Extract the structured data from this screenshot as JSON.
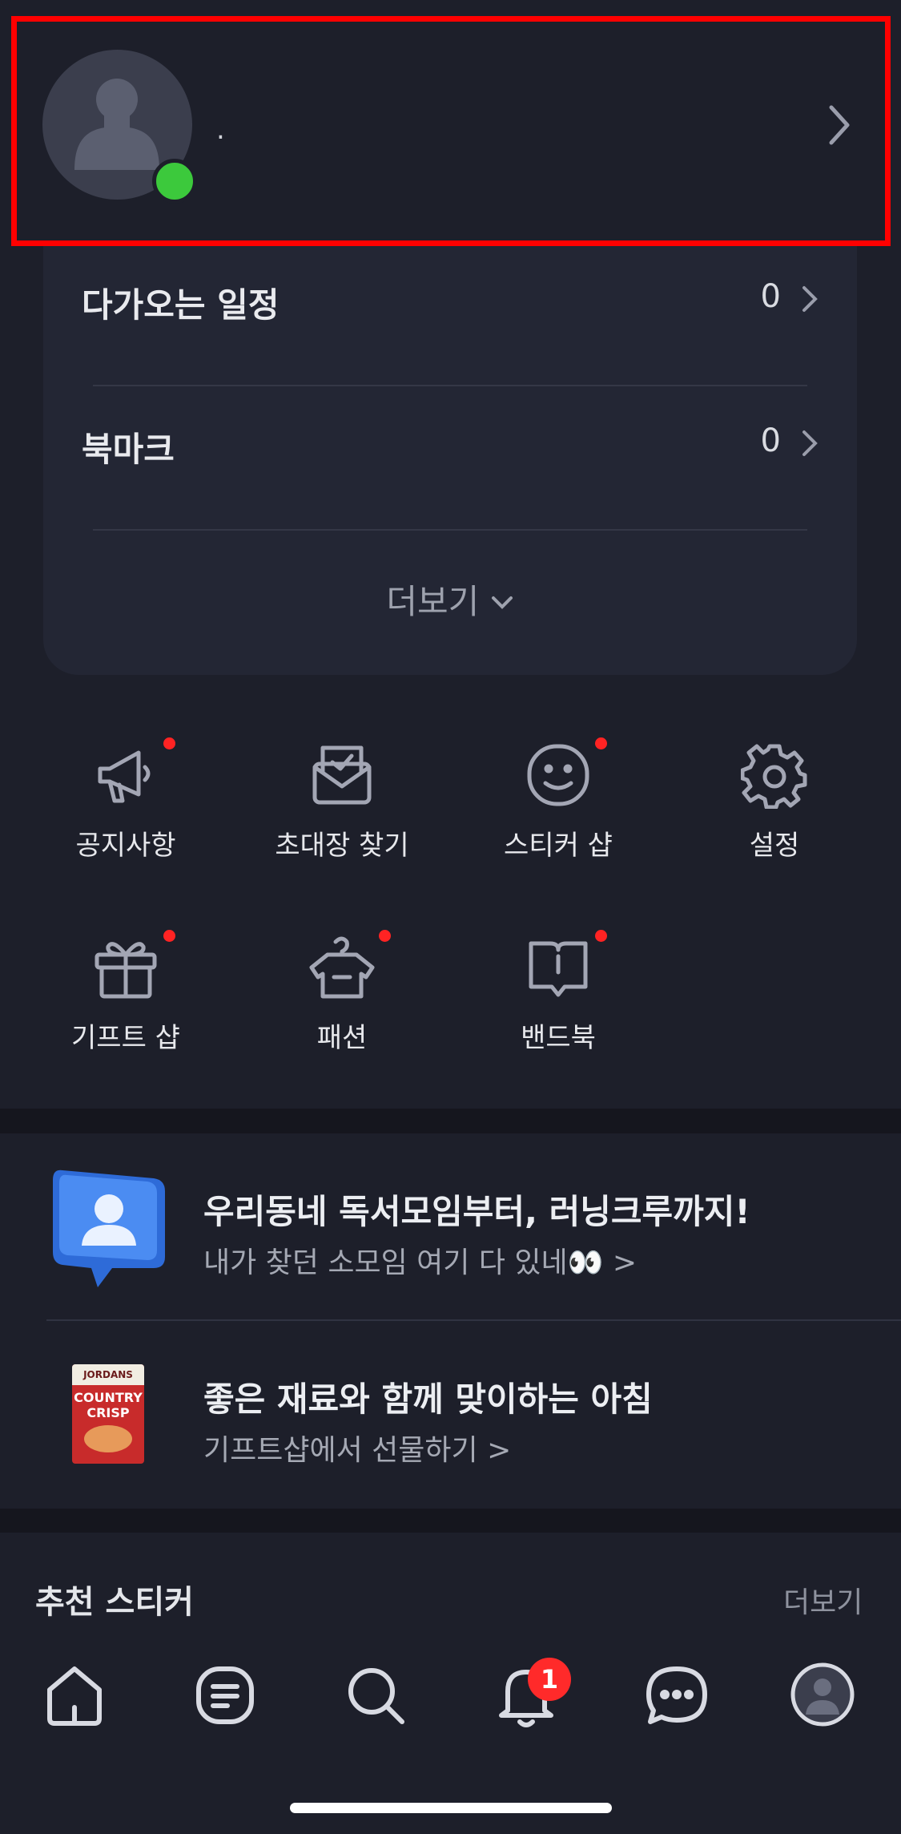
{
  "profile": {
    "name": "."
  },
  "card": {
    "rows": [
      {
        "label": "다가오는 일정",
        "count": "0"
      },
      {
        "label": "북마크",
        "count": "0"
      }
    ],
    "more_label": "더보기"
  },
  "menu": [
    {
      "label": "공지사항",
      "icon": "megaphone-icon",
      "dot": true
    },
    {
      "label": "초대장 찾기",
      "icon": "invitation-icon",
      "dot": false
    },
    {
      "label": "스티커 샵",
      "icon": "smile-icon",
      "dot": true
    },
    {
      "label": "설정",
      "icon": "gear-icon",
      "dot": false
    },
    {
      "label": "기프트 샵",
      "icon": "gift-icon",
      "dot": true
    },
    {
      "label": "패션",
      "icon": "hanger-icon",
      "dot": true
    },
    {
      "label": "밴드북",
      "icon": "book-icon",
      "dot": true
    }
  ],
  "promos": [
    {
      "title": "우리동네 독서모임부터, 러닝크루까지!",
      "subtitle": "내가 찾던 소모임 여기 다 있네👀 >"
    },
    {
      "title": "좋은 재료와 함께 맞이하는 아침",
      "subtitle": "기프트샵에서 선물하기 >",
      "image_text": [
        "JORDANS",
        "COUNTRY",
        "CRISP"
      ]
    }
  ],
  "stickers": {
    "title": "추천 스티커",
    "more_label": "더보기"
  },
  "nav": {
    "items": [
      "home-icon",
      "feed-icon",
      "search-icon",
      "bell-icon",
      "chat-icon",
      "profile-icon"
    ],
    "notification_badge": "1"
  },
  "colors": {
    "accent_red": "#ff2323",
    "online_green": "#3cc93c",
    "background": "#1d1f2a"
  }
}
